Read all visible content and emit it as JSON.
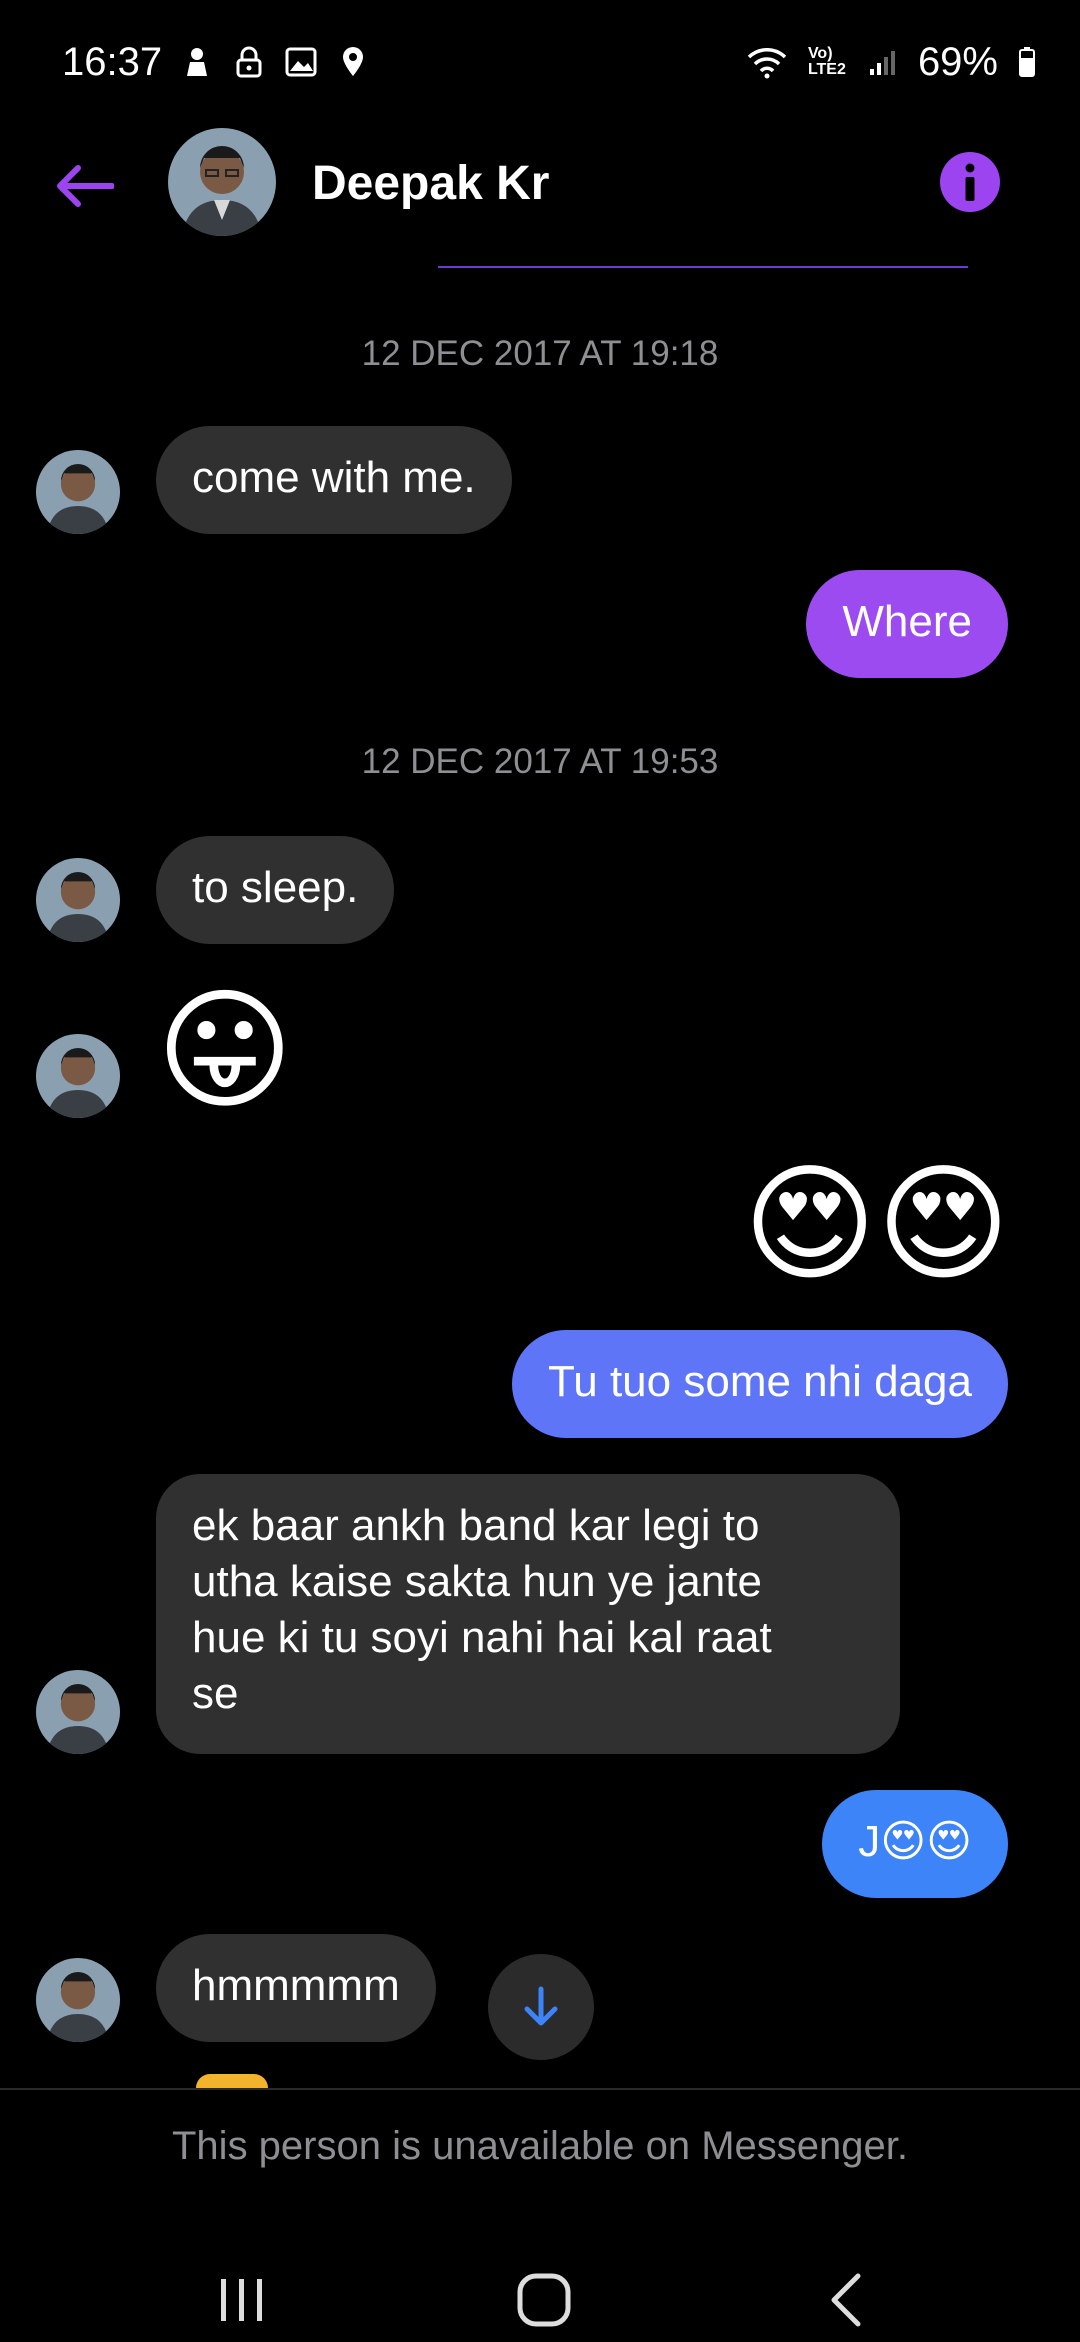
{
  "status_bar": {
    "time": "16:37",
    "battery": "69%",
    "icons_left": [
      "ghost-icon",
      "lock-icon",
      "image-icon",
      "location-icon"
    ],
    "network_label": "Vo)\nLTE2"
  },
  "header": {
    "contact_name": "Deepak Kr",
    "accent_color": "#9b44f0"
  },
  "messages": {
    "ts1": "12 DEC 2017 AT 19:18",
    "m1": "come with me.",
    "m2": "Where",
    "ts2": "12 DEC 2017 AT 19:53",
    "m3": "to sleep.",
    "m4_emoji": "😛",
    "m5_emoji": "😍😍",
    "m6": "Tu tuo some nhi daga",
    "m7_l1": "ek baar ankh band kar legi to",
    "m7_l2": "utha kaise sakta hun ye jante",
    "m7_l3": "hue ki tu soyi nahi hai kal raat",
    "m7_l4": "se",
    "m8": "J😍😍",
    "m9": "hmmmmm"
  },
  "footer": {
    "notice": "This person is unavailable on Messenger."
  },
  "colors": {
    "incoming_bubble": "#303030",
    "outgoing_purple": "#9b4bf0",
    "outgoing_blue": "#5f75f7",
    "outgoing_blue2": "#3c84f7"
  }
}
